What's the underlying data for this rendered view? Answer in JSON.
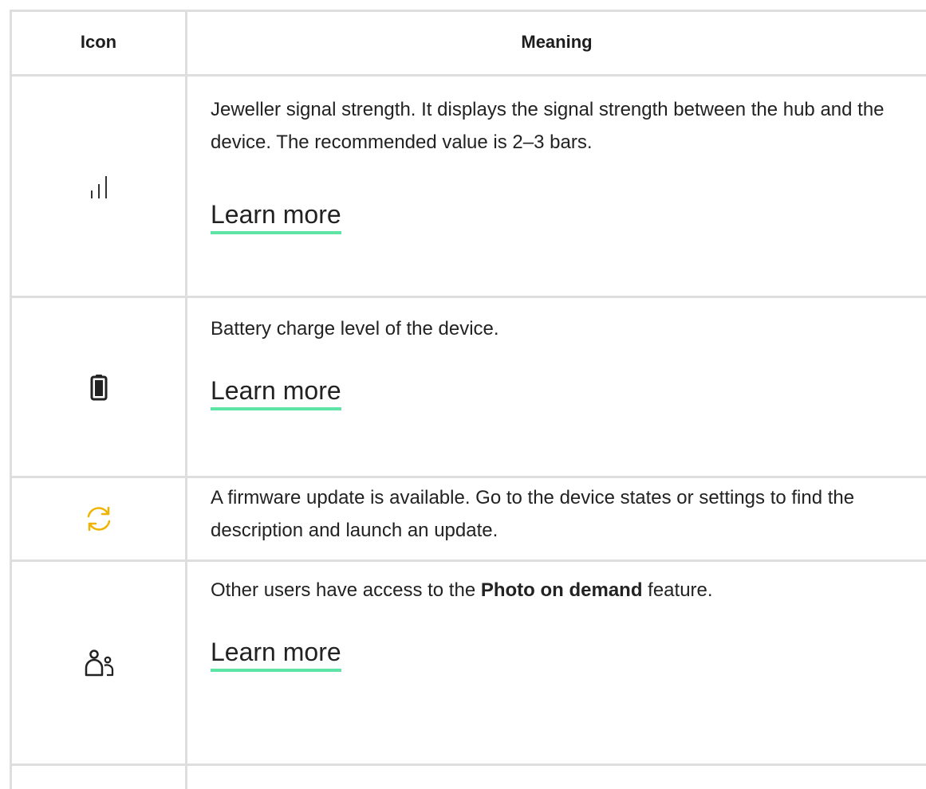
{
  "header": {
    "icon_col": "Icon",
    "meaning_col": "Meaning"
  },
  "rows": [
    {
      "icon": "signal-bars-icon",
      "text": "Jeweller signal strength. It displays the signal strength between the hub and the device. The recommended value is 2–3 bars.",
      "link": "Learn more"
    },
    {
      "icon": "battery-icon",
      "text": "Battery charge level of the device.",
      "link": "Learn more"
    },
    {
      "icon": "sync-update-icon",
      "icon_color": "#f0b400",
      "text": "A firmware update is available. Go to the device states or settings to find the description and launch an update."
    },
    {
      "icon": "users-icon",
      "text_before": "Other users have access to the ",
      "text_bold": "Photo on demand",
      "text_after": " feature.",
      "link": "Learn more"
    }
  ],
  "colors": {
    "border": "#dedede",
    "link_underline": "#5ee4a5",
    "accent": "#f0b400"
  }
}
